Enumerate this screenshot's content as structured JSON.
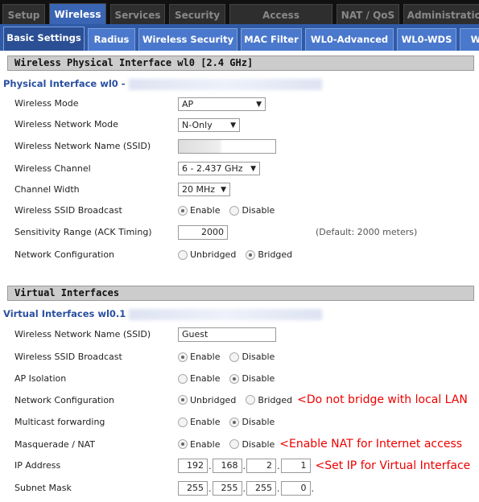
{
  "top_tabs": [
    "Setup",
    "Wireless",
    "Services",
    "Security",
    "Access Restrictions",
    "NAT / QoS",
    "Administration"
  ],
  "sub_tabs": [
    "Basic Settings",
    "Radius",
    "Wireless Security",
    "MAC Filter",
    "WL0-Advanced",
    "WL0-WDS",
    "W"
  ],
  "physical": {
    "section": "Wireless Physical Interface wl0 [2.4 GHz]",
    "title": "Physical Interface wl0 -",
    "wireless_mode_label": "Wireless Mode",
    "wireless_mode": "AP",
    "network_mode_label": "Wireless Network Mode",
    "network_mode": "N-Only",
    "ssid_label": "Wireless Network Name (SSID)",
    "channel_label": "Wireless Channel",
    "channel": "6 - 2.437 GHz",
    "width_label": "Channel Width",
    "width": "20 MHz",
    "broadcast_label": "Wireless SSID Broadcast",
    "enable": "Enable",
    "disable": "Disable",
    "ack_label": "Sensitivity Range (ACK Timing)",
    "ack": "2000",
    "ack_default": "(Default: 2000 meters)",
    "netconf_label": "Network Configuration",
    "unbridged": "Unbridged",
    "bridged": "Bridged"
  },
  "virtual": {
    "section": "Virtual Interfaces",
    "title": "Virtual Interfaces wl0.1",
    "ssid_label": "Wireless Network Name (SSID)",
    "ssid": "Guest",
    "broadcast_label": "Wireless SSID Broadcast",
    "isolation_label": "AP Isolation",
    "netconf_label": "Network Configuration",
    "multicast_label": "Multicast forwarding",
    "nat_label": "Masquerade / NAT",
    "ip_label": "IP Address",
    "ip": [
      "192",
      "168",
      "2",
      "1"
    ],
    "mask_label": "Subnet Mask",
    "mask": [
      "255",
      "255",
      "255",
      "0"
    ],
    "enable": "Enable",
    "disable": "Disable",
    "unbridged": "Unbridged",
    "bridged": "Bridged",
    "note_bridge": "<Do not bridge with local LAN",
    "note_nat": "<Enable NAT for Internet access",
    "note_ip": "<Set IP for Virtual Interface"
  }
}
